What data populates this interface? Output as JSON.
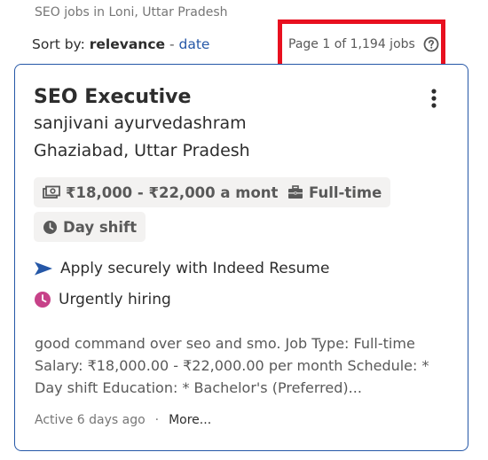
{
  "breadcrumb": "SEO jobs in Loni, Uttar Pradesh",
  "sort": {
    "label": "Sort by:",
    "active": "relevance",
    "separator": "-",
    "alternate": "date"
  },
  "pagination": {
    "text": "Page 1 of 1,194 jobs"
  },
  "job": {
    "title": "SEO Executive",
    "company": "sanjivani ayurvedashram",
    "location": "Ghaziabad, Uttar Pradesh",
    "salary": "₹18,000 - ₹22,000 a month",
    "job_type": "Full-time",
    "shift": "Day shift",
    "apply": "Apply securely with Indeed Resume",
    "urgent": "Urgently hiring",
    "snippet": "good command over seo and smo. Job Type: Full-time Salary: ₹18,000.00 - ₹22,000.00 per month Schedule: * Day shift Education: * Bachelor's (Preferred)...",
    "active": "Active 6 days ago",
    "footer_sep": "·",
    "more": "More..."
  },
  "colors": {
    "accent_link": "#2557a7",
    "highlight_box": "#e8101f",
    "urgent_icon": "#c74289",
    "chip_bg": "#f3f2f1"
  },
  "icons": {
    "help": "help-circle-icon",
    "menu": "kebab-menu-icon",
    "salary": "money-icon",
    "job_type": "briefcase-icon",
    "shift": "clock-icon",
    "apply": "send-arrow-icon",
    "urgent": "urgent-clock-icon"
  }
}
